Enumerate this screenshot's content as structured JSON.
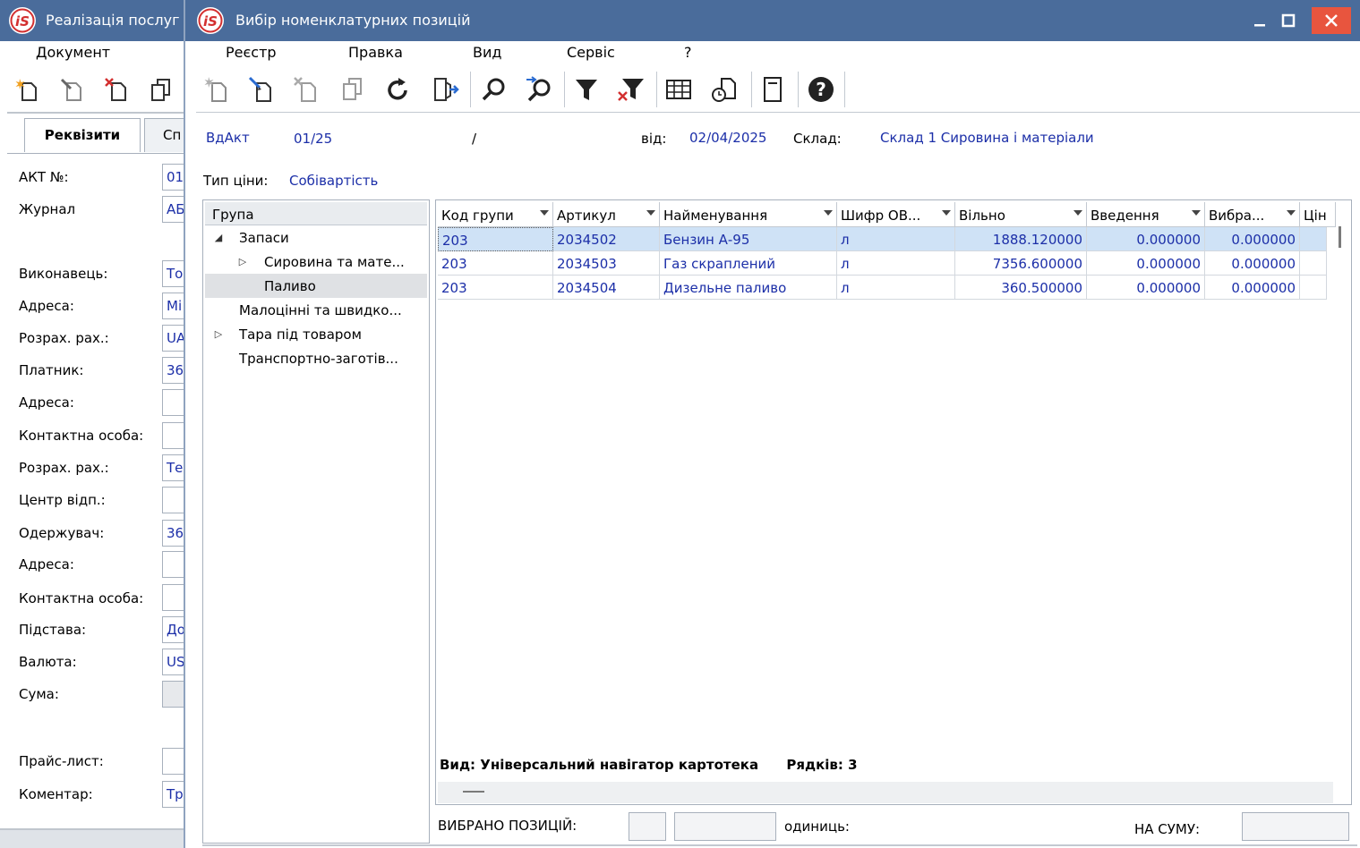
{
  "background_window": {
    "title": "Реалізація послуг",
    "menu": "Документ",
    "tabs": [
      "Реквізити",
      "Сп"
    ],
    "fields": [
      {
        "label": "АКТ №:",
        "value": "01"
      },
      {
        "label": "Журнал",
        "value": "АБ"
      },
      {
        "label": "Виконавець:",
        "value": "То"
      },
      {
        "label": "Адреса:",
        "value": "Мі"
      },
      {
        "label": "Розрах. рах.:",
        "value": "UA"
      },
      {
        "label": "Платник:",
        "value": "36"
      },
      {
        "label": "Адреса:",
        "value": ""
      },
      {
        "label": "Контактна особа:",
        "value": ""
      },
      {
        "label": "Розрах. рах.:",
        "value": "Те"
      },
      {
        "label": "Центр відп.:",
        "value": ""
      },
      {
        "label": "Одержувач:",
        "value": "36"
      },
      {
        "label": "Адреса:",
        "value": ""
      },
      {
        "label": "Контактна особа:",
        "value": ""
      },
      {
        "label": "Підстава:",
        "value": "До"
      },
      {
        "label": "Валюта:",
        "value": "US"
      },
      {
        "label": "Сума:",
        "value": ""
      },
      {
        "label": "Прайс-лист:",
        "value": ""
      },
      {
        "label": "Коментар:",
        "value": "Тр"
      }
    ]
  },
  "dialog": {
    "title": "Вибір номенклатурних позицій",
    "menu": [
      "Реєстр",
      "Правка",
      "Вид",
      "Сервіс",
      "?"
    ],
    "toolbar_icons": [
      "new-icon",
      "edit-icon",
      "delete-icon",
      "copy-icon",
      "refresh-icon",
      "export-icon",
      "search-icon",
      "search-next-icon",
      "filter-icon",
      "clear-filter-icon",
      "table-icon",
      "history-icon",
      "card-icon",
      "help-icon"
    ],
    "header": {
      "doc_type": "ВдАкт",
      "doc_number": "01/25",
      "slash": "/",
      "date_label": "від:",
      "date": "02/04/2025",
      "warehouse_label": "Склад:",
      "warehouse": "Склад 1 Сировина і матеріали",
      "price_type_label": "Тип ціни:",
      "price_type": "Собівартість"
    },
    "tree": {
      "header": "Група",
      "items": [
        {
          "label": "Запаси"
        },
        {
          "label": "Сировина та мате..."
        },
        {
          "label": "Паливо"
        },
        {
          "label": "Малоцінні та швидко..."
        },
        {
          "label": "Тара під товаром"
        },
        {
          "label": "Транспортно-заготів..."
        }
      ]
    },
    "grid": {
      "columns": [
        "Код групи",
        "Артикул",
        "Найменування",
        "Шифр ОВ...",
        "Вільно",
        "Введення",
        "Вибра...",
        "Цін"
      ],
      "rows": [
        {
          "group": "203",
          "article": "2034502",
          "name": "Бензин А-95",
          "unit": "л",
          "free": "1888.120000",
          "entered": "0.000000",
          "selected": "0.000000"
        },
        {
          "group": "203",
          "article": "2034503",
          "name": "Газ скраплений",
          "unit": "л",
          "free": "7356.600000",
          "entered": "0.000000",
          "selected": "0.000000"
        },
        {
          "group": "203",
          "article": "2034504",
          "name": "Дизельне паливо",
          "unit": "л",
          "free": "360.500000",
          "entered": "0.000000",
          "selected": "0.000000"
        }
      ],
      "view_status": "Вид: Універсальний навігатор картотека",
      "rows_count": "Рядків: 3"
    },
    "footer": {
      "selected_label": "ВИБРАНО ПОЗИЦІЙ:",
      "units_label": "одиниць:",
      "sum_label": "НА СУМУ:"
    }
  }
}
